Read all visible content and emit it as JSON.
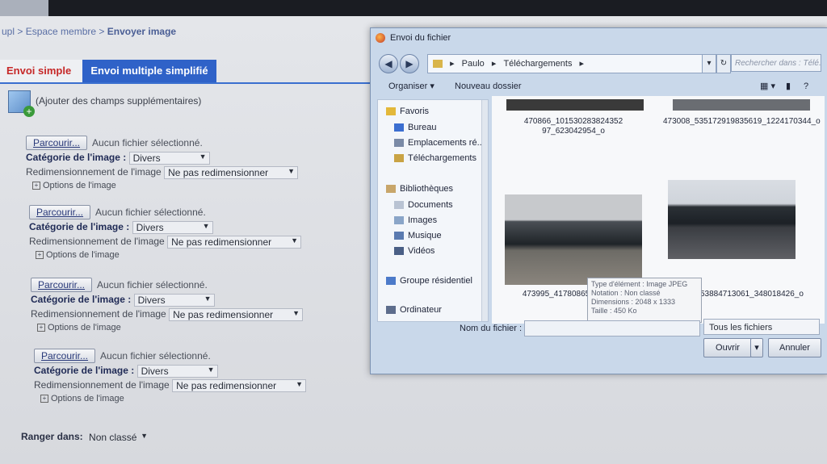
{
  "breadcrumb": {
    "prefix": "upl > Espace membre > ",
    "current": "Envoyer image"
  },
  "tabs": [
    {
      "label": "Envoi simple"
    },
    {
      "label": "Envoi multiple simplifié"
    }
  ],
  "add_fields": {
    "label": "(Ajouter des champs supplémentaires)"
  },
  "upload_rows": [
    {
      "browse": "Parcourir...",
      "no_file": "Aucun fichier sélectionné.",
      "category_label": "Catégorie de l'image :",
      "category_value": "Divers",
      "resize_label": "Redimensionnement de l'image",
      "resize_value": "Ne pas redimensionner",
      "options_label": "Options de l'image"
    },
    {
      "browse": "Parcourir...",
      "no_file": "Aucun fichier sélectionné.",
      "category_label": "Catégorie de l'image :",
      "category_value": "Divers",
      "resize_label": "Redimensionnement de l'image",
      "resize_value": "Ne pas redimensionner",
      "options_label": "Options de l'image"
    },
    {
      "browse": "Parcourir...",
      "no_file": "Aucun fichier sélectionné.",
      "category_label": "Catégorie de l'image :",
      "category_value": "Divers",
      "resize_label": "Redimensionnement de l'image",
      "resize_value": "Ne pas redimensionner",
      "options_label": "Options de l'image"
    },
    {
      "browse": "Parcourir...",
      "no_file": "Aucun fichier sélectionné.",
      "category_label": "Catégorie de l'image :",
      "category_value": "Divers",
      "resize_label": "Redimensionnement de l'image",
      "resize_value": "Ne pas redimensionner",
      "options_label": "Options de l'image"
    }
  ],
  "ranger": {
    "label": "Ranger dans:",
    "value": "Non classé"
  },
  "dialog": {
    "title": "Envoi du fichier",
    "path": [
      "Paulo",
      "Téléchargements"
    ],
    "search_placeholder": "Rechercher dans : Télé...",
    "toolbar": {
      "organize": "Organiser ▾",
      "new_folder": "Nouveau dossier"
    },
    "nav": {
      "favoris": "Favoris",
      "bureau": "Bureau",
      "emplacements": "Emplacements ré...",
      "telechargements": "Téléchargements",
      "bibliotheques": "Bibliothèques",
      "documents": "Documents",
      "images": "Images",
      "musique": "Musique",
      "videos": "Vidéos",
      "groupe": "Groupe résidentiel",
      "ordinateur": "Ordinateur"
    },
    "files": [
      {
        "name": "470866_101530283824352 97_623042954_o"
      },
      {
        "name": "473008_535172919835619_1224170344_o"
      },
      {
        "name": "473995_4178086582889_o"
      },
      {
        "name": "...653884713061_348018426_o"
      }
    ],
    "tooltip": {
      "type": "Type d'élément : Image JPEG",
      "rating": "Notation : Non classé",
      "dimensions": "Dimensions : 2048 x 1333",
      "size": "Taille : 450 Ko"
    },
    "filename_label": "Nom du fichier :",
    "filter_value": "Tous les fichiers",
    "open_label": "Ouvrir",
    "cancel_label": "Annuler"
  }
}
